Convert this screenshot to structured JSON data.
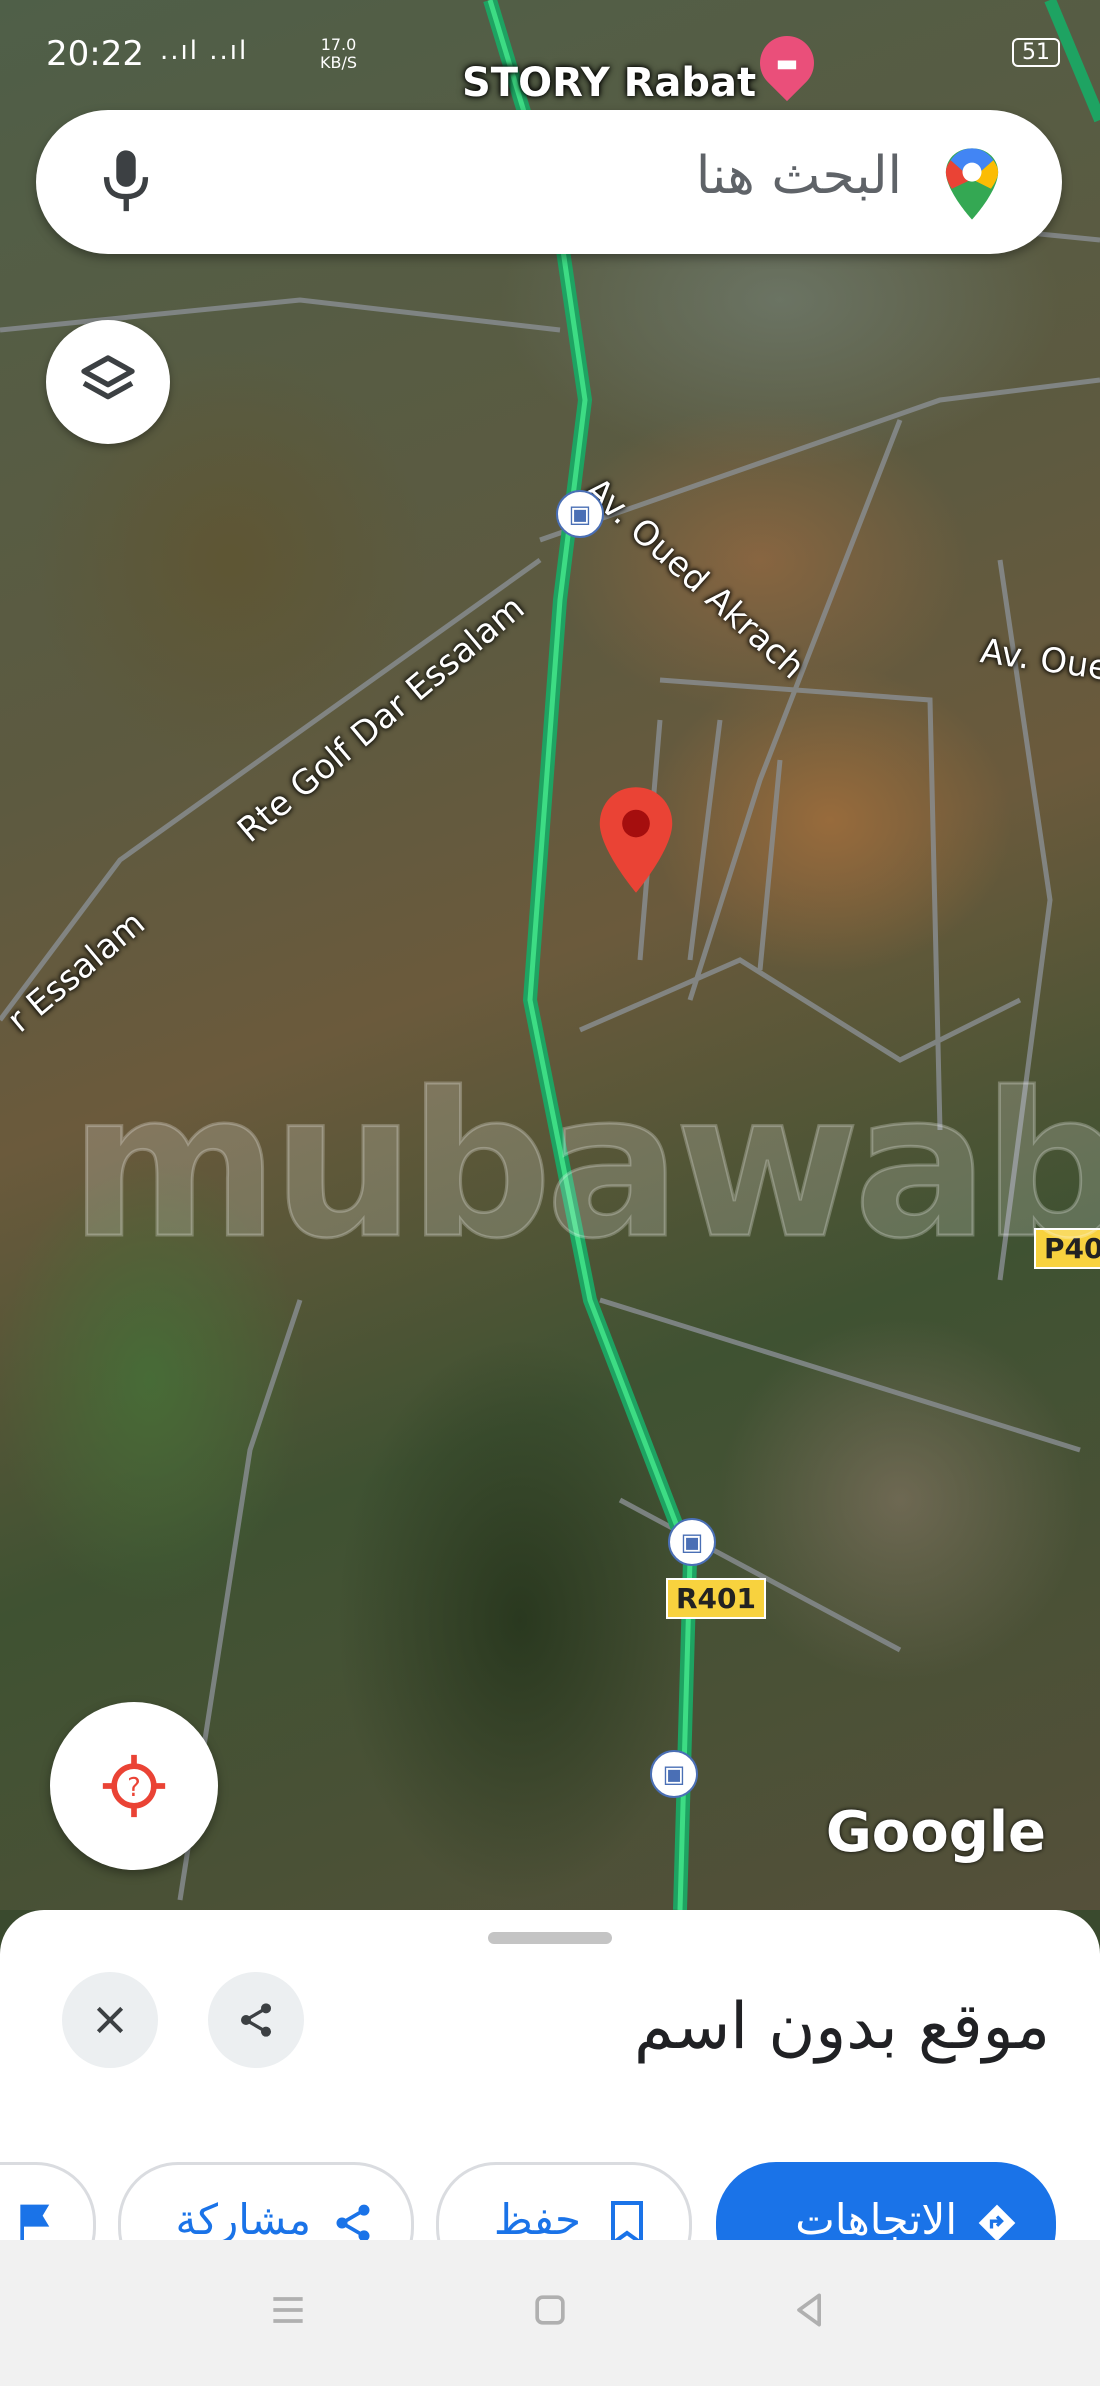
{
  "status_bar": {
    "time": "20:22",
    "signal": "..ıl ..ıl",
    "speed_value": "17.0",
    "speed_unit": "KB/S",
    "battery": "51"
  },
  "map": {
    "poi_label": "STORY Rabat",
    "road_labels": [
      "Av. Oued Akrach",
      "Av. Oue",
      "Rte Golf Dar Essalam",
      "r Essalam"
    ],
    "route_shields": [
      "R401",
      "P40"
    ],
    "watermark": "mubawab",
    "attribution": "Google",
    "accent_color": "#0f9d58",
    "pin_color": "#ea4335"
  },
  "search": {
    "placeholder": "البحث هنا"
  },
  "place_sheet": {
    "title": "موقع بدون اسم",
    "actions": {
      "directions": "الاتجاهات",
      "save": "حفظ",
      "share": "مشاركة"
    }
  }
}
